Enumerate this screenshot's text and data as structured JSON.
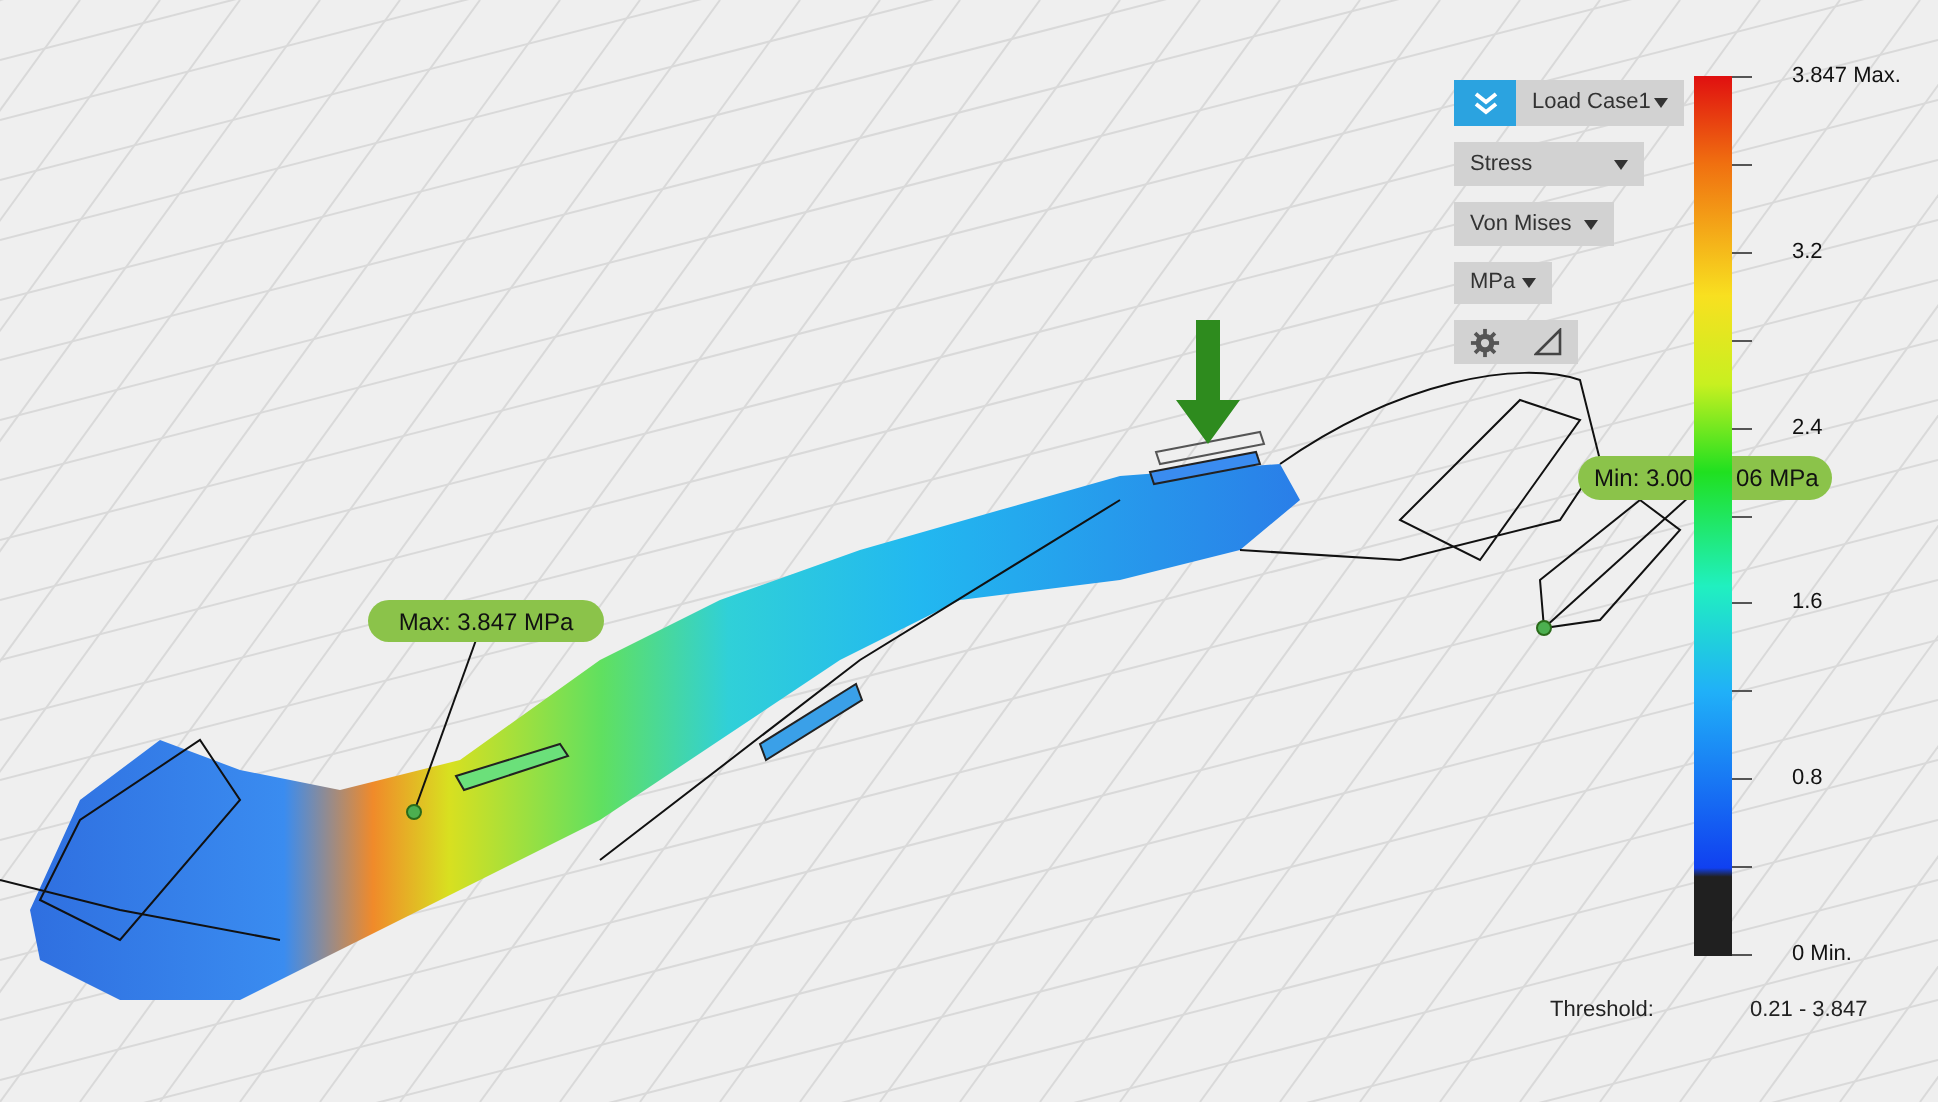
{
  "toolbar": {
    "load_case": "Load Case1",
    "result_type": "Stress",
    "criterion": "Von Mises",
    "unit": "MPa"
  },
  "legend": {
    "ticks": [
      "3.847 Max.",
      "3.2",
      "2.4",
      "1.6",
      "0.8",
      "0 Min."
    ],
    "threshold_label": "Threshold:",
    "threshold_range": "0.21 - 3.847"
  },
  "probes": {
    "max": "Max: 3.847 MPa",
    "min_parts": [
      "Min: 3.00",
      "06 MPa"
    ]
  }
}
